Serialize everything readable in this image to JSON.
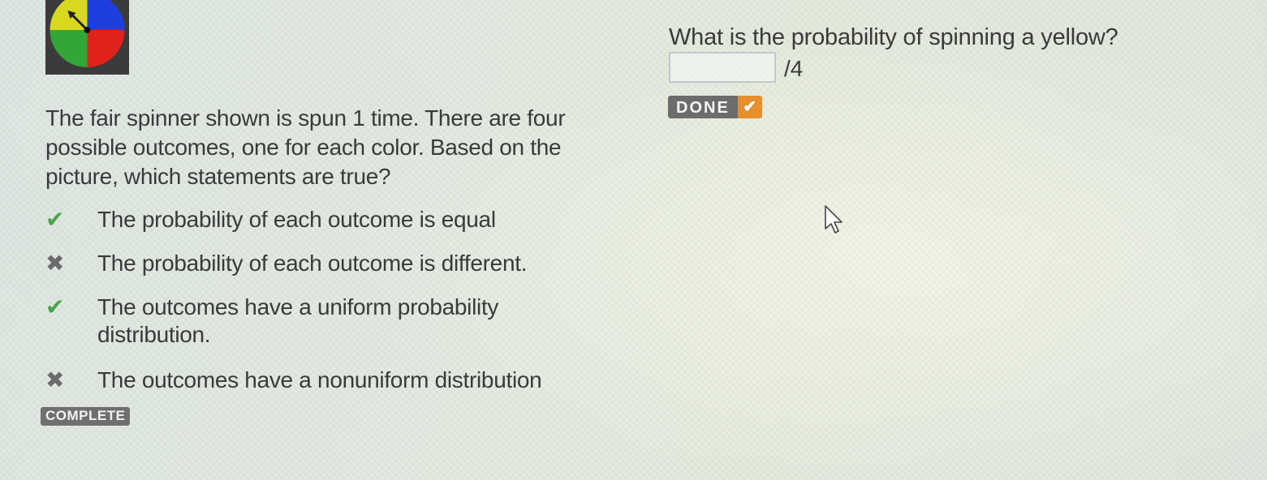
{
  "spinner": {
    "icon": "spinner-icon",
    "colors": {
      "top_left": "#d8d81e",
      "top_right": "#1f3ee0",
      "bottom_left": "#33a637",
      "bottom_right": "#e0221b"
    }
  },
  "prompt": {
    "text": "The fair spinner shown is spun 1 time. There are four possible outcomes, one for each color. Based on the picture, which statements are true?"
  },
  "options": [
    {
      "text": "The probability of each outcome is equal",
      "state": "correct",
      "icon": "check-icon",
      "mark": "✔"
    },
    {
      "text": "The probability of each outcome is different.",
      "state": "incorrect",
      "icon": "x-icon",
      "mark": "✖"
    },
    {
      "text": "The outcomes have a uniform probability distribution.",
      "state": "correct",
      "icon": "check-icon",
      "mark": "✔"
    },
    {
      "text": "The outcomes have a nonuniform distribution",
      "state": "incorrect",
      "icon": "x-icon",
      "mark": "✖"
    }
  ],
  "left_status": {
    "badge": "COMPLETE"
  },
  "question": {
    "text": "What is the probability of spinning a yellow?",
    "answer_value": "",
    "denominator": "/4",
    "done_label": "DONE",
    "done_icon": "checkmark-icon",
    "done_mark": "✔"
  },
  "colors": {
    "check": "#49a44a",
    "cross": "#6b6b6b",
    "done_accent": "#e68f2c",
    "badge_bg": "#6f6f6f"
  }
}
